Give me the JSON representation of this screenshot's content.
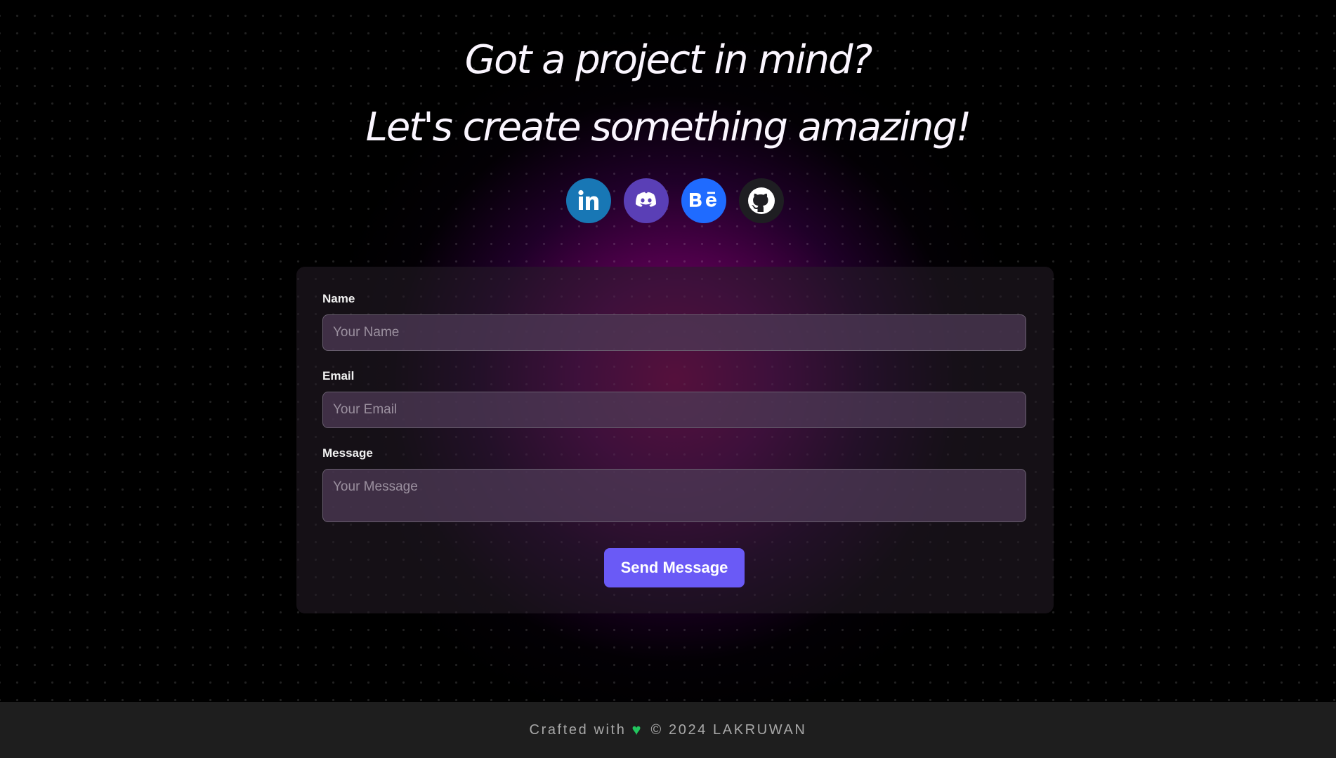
{
  "hero": {
    "title": "Got a project in mind?",
    "subtitle": "Let's create something amazing!"
  },
  "socials": [
    {
      "name": "linkedin",
      "icon": "linkedin-icon",
      "color": "#1877b5"
    },
    {
      "name": "discord",
      "icon": "discord-icon",
      "color": "#5a3fb6"
    },
    {
      "name": "behance",
      "icon": "behance-icon",
      "color": "#1f6bff"
    },
    {
      "name": "github",
      "icon": "github-icon",
      "color": "#1e1e22"
    }
  ],
  "form": {
    "name_label": "Name",
    "name_placeholder": "Your Name",
    "email_label": "Email",
    "email_placeholder": "Your Email",
    "message_label": "Message",
    "message_placeholder": "Your Message",
    "submit_label": "Send Message"
  },
  "footer": {
    "prefix": "Crafted with",
    "heart_icon": "heart-icon",
    "suffix": "© 2024 LAKRUWAN"
  },
  "colors": {
    "accent": "#6a5af6",
    "heart": "#22c55e",
    "glow": "#96005a"
  }
}
